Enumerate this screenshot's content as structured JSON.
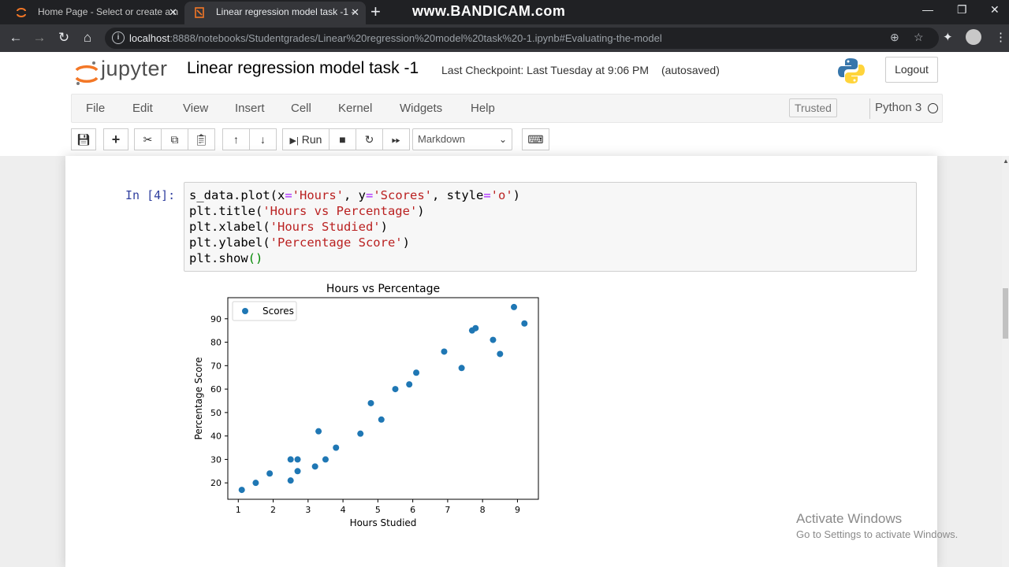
{
  "browser": {
    "tabs": [
      {
        "label": "Home Page - Select or create a n",
        "active": false
      },
      {
        "label": "Linear regression model task -1 -",
        "active": true
      }
    ],
    "watermark": "www.BANDICAM.com",
    "url_host": "localhost",
    "url_path": ":8888/notebooks/Studentgrades/Linear%20regression%20model%20task%20-1.ipynb#Evaluating-the-model"
  },
  "jupyter": {
    "logo_text": "jupyter",
    "notebook_title": "Linear regression model task -1",
    "checkpoint": "Last Checkpoint: Last Tuesday at 9:06 PM",
    "autosave": "(autosaved)",
    "logout_label": "Logout",
    "menu": [
      "File",
      "Edit",
      "View",
      "Insert",
      "Cell",
      "Kernel",
      "Widgets",
      "Help"
    ],
    "trusted_label": "Trusted",
    "kernel_label": "Python 3",
    "run_label": "Run",
    "cell_type": "Markdown"
  },
  "cell": {
    "prompt": "In [4]:",
    "code_lines": [
      "s_data.plot(x='Hours', y='Scores', style='o')",
      "plt.title('Hours vs Percentage')",
      "plt.xlabel('Hours Studied')",
      "plt.ylabel('Percentage Score')",
      "plt.show()"
    ]
  },
  "chart_data": {
    "type": "scatter",
    "title": "Hours vs Percentage",
    "xlabel": "Hours Studied",
    "ylabel": "Percentage Score",
    "xlim": [
      0.7,
      9.6
    ],
    "ylim": [
      13,
      99
    ],
    "xticks": [
      1,
      2,
      3,
      4,
      5,
      6,
      7,
      8,
      9
    ],
    "yticks": [
      20,
      30,
      40,
      50,
      60,
      70,
      80,
      90
    ],
    "legend_position": "top-left",
    "color": "#1f77b4",
    "series": [
      {
        "name": "Scores",
        "x": [
          2.5,
          5.1,
          3.2,
          8.5,
          3.5,
          1.5,
          9.2,
          5.5,
          8.3,
          2.7,
          7.7,
          5.9,
          4.5,
          3.3,
          1.1,
          8.9,
          2.5,
          1.9,
          6.1,
          7.4,
          2.7,
          4.8,
          3.8,
          6.9,
          7.8
        ],
        "y": [
          21,
          47,
          27,
          75,
          30,
          20,
          88,
          60,
          81,
          25,
          85,
          62,
          41,
          42,
          17,
          95,
          30,
          24,
          67,
          69,
          30,
          54,
          35,
          76,
          86
        ]
      }
    ]
  },
  "windows_watermark": {
    "line1": "Activate Windows",
    "line2": "Go to Settings to activate Windows."
  }
}
